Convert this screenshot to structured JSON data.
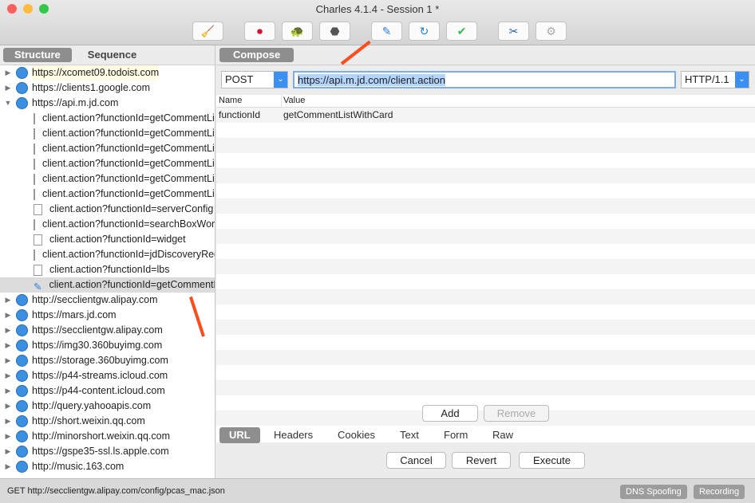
{
  "window": {
    "title": "Charles 4.1.4 - Session 1 *"
  },
  "toolbar": [
    {
      "name": "broom-icon",
      "g": "🧹"
    },
    {
      "name": "record-icon",
      "g": "⏺"
    },
    {
      "name": "throttle-turtle-icon",
      "g": "🐢"
    },
    {
      "name": "stop-hexagon-icon",
      "g": "⬣"
    },
    {
      "name": "compose-pen-icon",
      "g": "✎"
    },
    {
      "name": "repeat-refresh-icon",
      "g": "↻"
    },
    {
      "name": "validate-check-icon",
      "g": "✔"
    },
    {
      "name": "tools-icon",
      "g": "✂"
    },
    {
      "name": "settings-gear-icon",
      "g": "⚙"
    }
  ],
  "left": {
    "tabs": [
      "Structure",
      "Sequence"
    ],
    "items": [
      {
        "t": "host",
        "label": "https://xcomet09.todoist.com"
      },
      {
        "t": "host",
        "label": "https://clients1.google.com"
      },
      {
        "t": "open",
        "label": "https://api.m.jd.com"
      },
      {
        "t": "doc",
        "label": "client.action?functionId=getCommentListWithCard"
      },
      {
        "t": "doc",
        "label": "client.action?functionId=getCommentListWithCard"
      },
      {
        "t": "doc",
        "label": "client.action?functionId=getCommentListWithCard"
      },
      {
        "t": "doc",
        "label": "client.action?functionId=getCommentListWithCard"
      },
      {
        "t": "doc",
        "label": "client.action?functionId=getCommentListWithCard"
      },
      {
        "t": "doc",
        "label": "client.action?functionId=getCommentListWithCard"
      },
      {
        "t": "doc",
        "label": "client.action?functionId=serverConfig"
      },
      {
        "t": "doc",
        "label": "client.action?functionId=searchBoxWord"
      },
      {
        "t": "doc",
        "label": "client.action?functionId=widget"
      },
      {
        "t": "doc",
        "label": "client.action?functionId=jdDiscoveryRedPoint"
      },
      {
        "t": "doc",
        "label": "client.action?functionId=lbs"
      },
      {
        "t": "compose",
        "label": "client.action?functionId=getCommentListWithCard"
      },
      {
        "t": "host",
        "label": "http://secclientgw.alipay.com"
      },
      {
        "t": "host",
        "label": "https://mars.jd.com"
      },
      {
        "t": "host",
        "label": "https://secclientgw.alipay.com"
      },
      {
        "t": "host",
        "label": "https://img30.360buyimg.com"
      },
      {
        "t": "host",
        "label": "https://storage.360buyimg.com"
      },
      {
        "t": "host",
        "label": "https://p44-streams.icloud.com"
      },
      {
        "t": "host",
        "label": "https://p44-content.icloud.com"
      },
      {
        "t": "host",
        "label": "http://query.yahooapis.com"
      },
      {
        "t": "host",
        "label": "http://short.weixin.qq.com"
      },
      {
        "t": "host",
        "label": "http://minorshort.weixin.qq.com"
      },
      {
        "t": "host",
        "label": "https://gspe35-ssl.ls.apple.com"
      },
      {
        "t": "host",
        "label": "http://music.163.com"
      }
    ]
  },
  "compose": {
    "tab": "Compose",
    "method": "POST",
    "url": "https://api.m.jd.com/client.action",
    "protocol": "HTTP/1.1",
    "columns": [
      "Name",
      "Value"
    ],
    "params": [
      {
        "name": "functionId",
        "value": "getCommentListWithCard"
      }
    ],
    "add": "Add",
    "remove": "Remove",
    "tabs": [
      "URL",
      "Headers",
      "Cookies",
      "Text",
      "Form",
      "Raw"
    ],
    "cancel": "Cancel",
    "revert": "Revert",
    "execute": "Execute"
  },
  "status": {
    "text": "GET http://secclientgw.alipay.com/config/pcas_mac.json",
    "dns": "DNS Spoofing",
    "recording": "Recording"
  }
}
